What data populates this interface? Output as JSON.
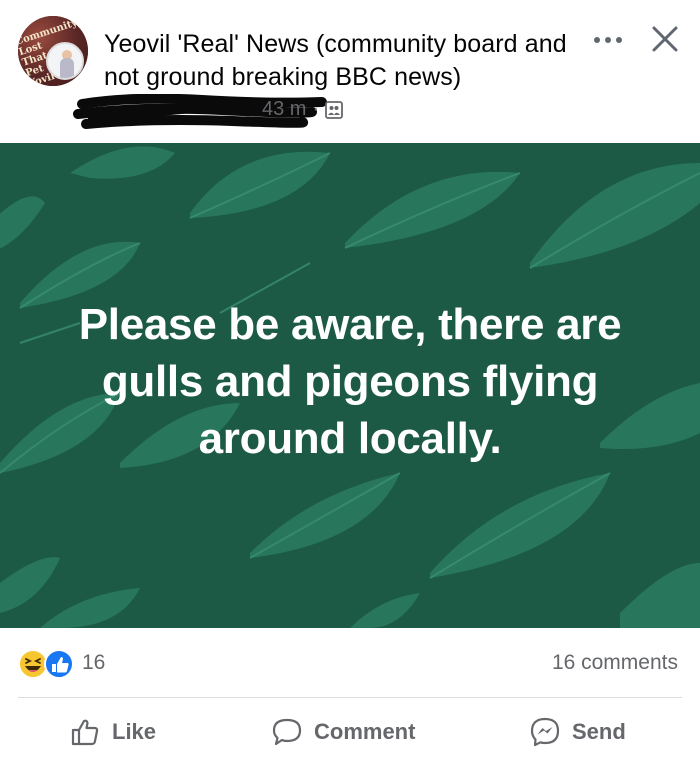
{
  "post": {
    "page_name": "Yeovil 'Real' News (community board and not ground breaking BBC news)",
    "timestamp": "43 m",
    "separator": "·",
    "audience_icon": "group-icon",
    "avatar_text": "Community Lost That Pet Yovil",
    "body_text": "Please be aware, there are gulls and pigeons flying around locally.",
    "background_color": "#1c5a46",
    "leaf_color": "#2a7a5f",
    "text_color": "#ffffff"
  },
  "header_actions": {
    "more_icon": "more-options-icon",
    "close_icon": "close-icon"
  },
  "reactions": {
    "icons": [
      "haha-reaction-icon",
      "like-reaction-icon"
    ],
    "count": "16",
    "comments": "16 comments"
  },
  "actions": {
    "like_label": "Like",
    "comment_label": "Comment",
    "send_label": "Send",
    "like_icon": "thumbs-up-icon",
    "comment_icon": "speech-bubble-icon",
    "send_icon": "messenger-icon"
  }
}
